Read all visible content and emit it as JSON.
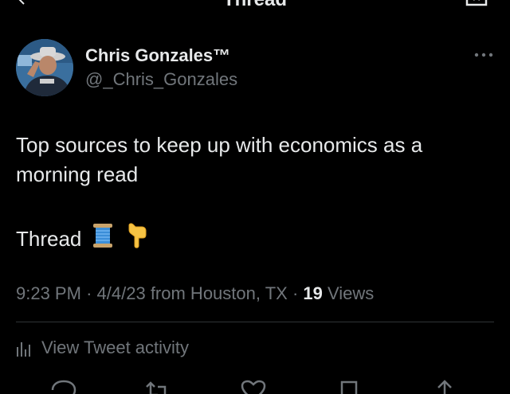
{
  "header": {
    "title": "Thread"
  },
  "author": {
    "name": "Chris Gonzales™",
    "handle": "@_Chris_Gonzales"
  },
  "tweet": {
    "line1": "Top sources to keep up with economics as a",
    "line2": "morning read",
    "line3": "Thread",
    "emojis": [
      "spool-of-thread",
      "backhand-index-pointing-down"
    ]
  },
  "meta": {
    "time": "9:23 PM",
    "date": "4/4/23",
    "location": "from Houston, TX",
    "separator": "·",
    "views_count": "19",
    "views_label": "Views"
  },
  "activity": {
    "label": "View Tweet activity"
  },
  "colors": {
    "background": "#000000",
    "text": "#e7e9ea",
    "muted": "#71767b",
    "divider": "#2f3336"
  }
}
